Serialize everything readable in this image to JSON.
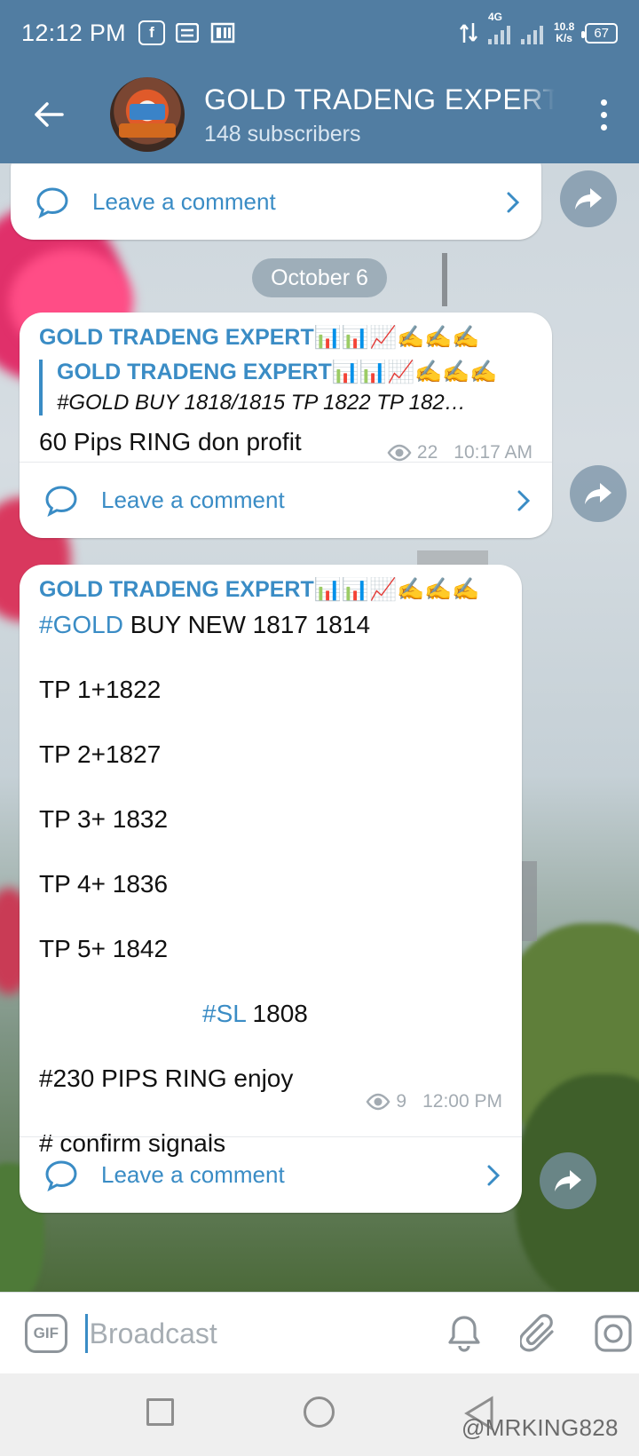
{
  "status_bar": {
    "time": "12:12 PM",
    "network": "4G",
    "speed_value": "10.8",
    "speed_unit": "K/s",
    "battery": "67",
    "app_icons": [
      "facebook-icon",
      "message-icon",
      "browser-icon"
    ]
  },
  "header": {
    "channel_name": "GOLD TRADENG EXPERT📊📊📈✍️✍️✍️",
    "subscribers": "148 subscribers"
  },
  "chat": {
    "date_separator": "October 6",
    "comment_label": "Leave a comment",
    "messages": [
      {
        "sender": "GOLD TRADENG EXPERT📊📊📈✍️✍️✍️",
        "forward_title": "GOLD TRADENG EXPERT📊📊📈✍️✍️✍️",
        "forward_text": "#GOLD BUY 1818/1815  TP 1822 TP 182…",
        "text": "60 Pips RING don profit",
        "views": "22",
        "time": "10:17 AM"
      },
      {
        "sender": "GOLD TRADENG EXPERT📊📊📈✍️✍️✍️",
        "line1_tag": "#GOLD",
        "line1_rest": " BUY NEW 1817 1814",
        "tp1": "TP 1+1822",
        "tp2": "TP 2+1827",
        "tp3": "TP 3+ 1832",
        "tp4": "TP 4+ 1836",
        "tp5": "TP 5+ 1842",
        "sl_tag": "#SL",
        "sl_value": " 1808",
        "pips": "#230 PIPS RING enjoy",
        "confirm": "# confirm signals",
        "views": "9",
        "time": "12:00 PM"
      }
    ]
  },
  "input_bar": {
    "gif_label": "GIF",
    "placeholder": "Broadcast"
  },
  "watermark": "@MRKING828",
  "colors": {
    "header_bg": "#517da2",
    "accent": "#3a8cc5",
    "meta": "#a3abb2"
  }
}
